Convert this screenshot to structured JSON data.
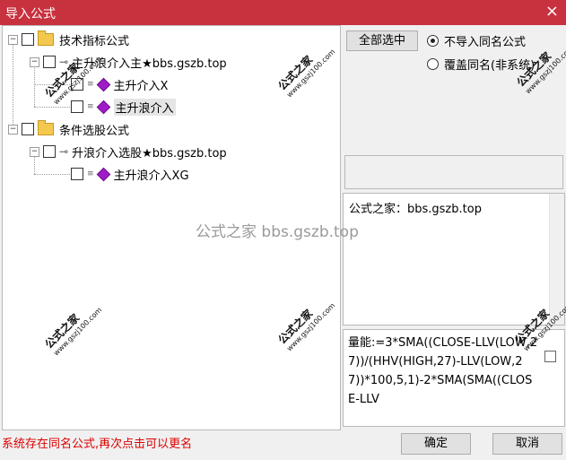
{
  "window": {
    "title": "导入公式",
    "close_glyph": "×"
  },
  "tree": {
    "group1": {
      "label": "技术指标公式"
    },
    "formula1": {
      "label": "主升浪介入主★bbs.gszb.top"
    },
    "child1": {
      "label": "主升介入X"
    },
    "child2": {
      "label": "主升浪介入"
    },
    "group2": {
      "label": "条件选股公式"
    },
    "formula2": {
      "label": "升浪介入选股★bbs.gszb.top"
    },
    "child3": {
      "label": "主升浪介入XG"
    }
  },
  "options": {
    "select_all_label": "全部选中",
    "radio_skip_label": "不导入同名公式",
    "radio_overwrite_label": "覆盖同名(非系统)",
    "selected": "radio_skip"
  },
  "info_panel": {
    "text": "公式之家：bbs.gszb.top"
  },
  "formula_panel": {
    "text": "量能:=3*SMA((CLOSE-LLV(LOW,27))/(HHV(HIGH,27)-LLV(LOW,27))*100,5,1)-2*SMA(SMA((CLOSE-LLV"
  },
  "status_text": "系统存在同名公式,再次点击可以更名",
  "buttons": {
    "ok": "确定",
    "cancel": "取消"
  },
  "watermark": {
    "brand": "公式之家",
    "site": "www.gszj100.com",
    "center_text": "公式之家 bbs.gszb.top"
  }
}
